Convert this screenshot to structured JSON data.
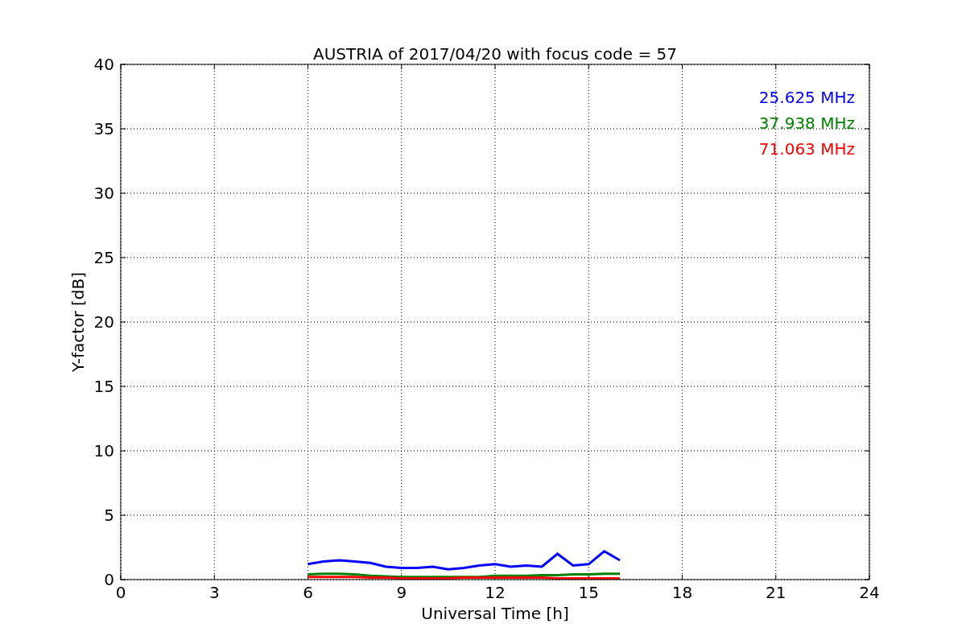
{
  "figure": {
    "chart_data": {
      "type": "line",
      "title": "AUSTRIA of 2017/04/20 with focus code = 57",
      "xlabel": "Universal Time [h]",
      "ylabel": "Y-factor [dB]",
      "x": [
        6,
        6.5,
        7,
        7.5,
        8,
        8.5,
        9,
        9.5,
        10,
        10.5,
        11,
        11.5,
        12,
        12.5,
        13,
        13.5,
        14,
        14.5,
        15,
        15.5,
        16
      ],
      "series": [
        {
          "name": "25.625 MHz",
          "color": "#0000ff",
          "values": [
            1.2,
            1.4,
            1.5,
            1.4,
            1.3,
            1.0,
            0.9,
            0.9,
            1.0,
            0.8,
            0.9,
            1.1,
            1.2,
            1.0,
            1.1,
            1.0,
            2.0,
            1.1,
            1.2,
            2.2,
            1.5
          ]
        },
        {
          "name": "37.938 MHz",
          "color": "#008000",
          "values": [
            0.4,
            0.45,
            0.45,
            0.4,
            0.3,
            0.25,
            0.2,
            0.2,
            0.2,
            0.2,
            0.2,
            0.2,
            0.3,
            0.3,
            0.3,
            0.35,
            0.35,
            0.4,
            0.4,
            0.45,
            0.45
          ]
        },
        {
          "name": "71.063 MHz",
          "color": "#ff0000",
          "values": [
            0.2,
            0.2,
            0.2,
            0.2,
            0.15,
            0.15,
            0.1,
            0.1,
            0.1,
            0.1,
            0.15,
            0.15,
            0.15,
            0.15,
            0.15,
            0.15,
            0.1,
            0.1,
            0.1,
            0.1,
            0.1
          ]
        }
      ],
      "grid": true,
      "xlim": [
        0,
        24
      ],
      "ylim": [
        0,
        40
      ],
      "xticks": [
        0,
        3,
        6,
        9,
        12,
        15,
        18,
        21,
        24
      ],
      "yticks": [
        0,
        5,
        10,
        15,
        20,
        25,
        30,
        35,
        40
      ]
    }
  }
}
